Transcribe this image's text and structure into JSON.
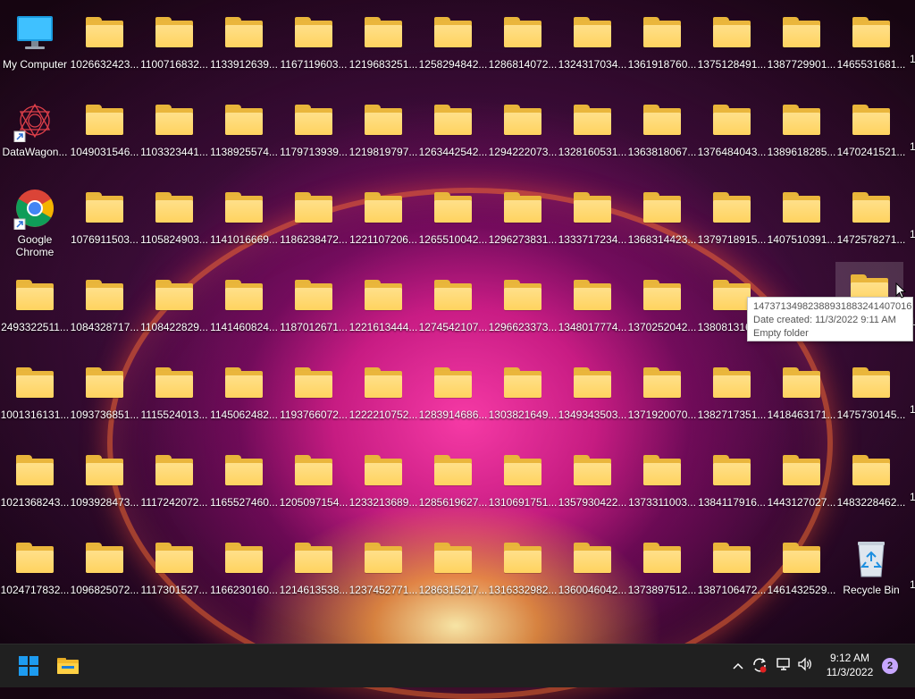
{
  "desktop": {
    "system_icons": [
      {
        "name": "my-computer",
        "label": "My Computer",
        "icon": "monitor-icon"
      },
      {
        "name": "datawagon",
        "label": "DataWagon...",
        "icon": "datawagon-icon"
      },
      {
        "name": "google-chrome",
        "label": "Google Chrome",
        "icon": "chrome-icon"
      },
      {
        "name": "recycle-bin",
        "label": "Recycle Bin",
        "icon": "recycle-bin-icon"
      }
    ],
    "folder_columns": [
      [
        "",
        "",
        "",
        "2493322511...",
        "1001316131...",
        "1021368243...",
        "1024717832..."
      ],
      [
        "1026632423...",
        "1049031546...",
        "1076911503...",
        "1084328717...",
        "1093736851...",
        "1093928473...",
        "1096825072..."
      ],
      [
        "1100716832...",
        "1103323441...",
        "1105824903...",
        "1108422829...",
        "1115524013...",
        "1117242072...",
        "1117301527..."
      ],
      [
        "1133912639...",
        "1138925574...",
        "1141016669...",
        "1141460824...",
        "1145062482...",
        "1165527460...",
        "1166230160..."
      ],
      [
        "1167119603...",
        "1179713939...",
        "1186238472...",
        "1187012671...",
        "1193766072...",
        "1205097154...",
        "1214613538..."
      ],
      [
        "1219683251...",
        "1219819797...",
        "1221107206...",
        "1221613444...",
        "1222210752...",
        "1233213689...",
        "1237452771..."
      ],
      [
        "1258294842...",
        "1263442542...",
        "1265510042...",
        "1274542107...",
        "1283914686...",
        "1285619627...",
        "1286315217..."
      ],
      [
        "1286814072...",
        "1294222073...",
        "1296273831...",
        "1296623373...",
        "1303821649...",
        "1310691751...",
        "1316332982..."
      ],
      [
        "1324317034...",
        "1328160531...",
        "1333717234...",
        "1348017774...",
        "1349343503...",
        "1357930422...",
        "1360046042..."
      ],
      [
        "1361918760...",
        "1363818067...",
        "1368314423...",
        "1370252042...",
        "1371920070...",
        "1373311003...",
        "1373897512..."
      ],
      [
        "1375128491...",
        "1376484043...",
        "1379718915...",
        "1380813160...",
        "1382717351...",
        "1384117916...",
        "1387106472..."
      ],
      [
        "1387729901...",
        "1389618285...",
        "1407510391...",
        "",
        "1418463171...",
        "1443127027...",
        "1461432529..."
      ],
      [
        "1465531681...",
        "1470241521...",
        "1472578271...",
        "",
        "1475730145...",
        "1483228462...",
        ""
      ]
    ],
    "edge_labels": [
      "1",
      "1",
      "1",
      "1",
      "1",
      "1",
      "1"
    ]
  },
  "tooltip": {
    "name": "1473713498238893188324140701​6",
    "name_full": "14737134982388931883241407016",
    "date_created": "Date created: 11/3/2022 9:11 AM",
    "status": "Empty folder"
  },
  "taskbar": {
    "start_icon": "windows-start-icon",
    "explorer_icon": "file-explorer-icon",
    "tray": {
      "chevron": "^",
      "clock_time": "9:12 AM",
      "clock_date": "11/3/2022",
      "notification_count": "2"
    }
  },
  "colors": {
    "taskbar": "#202020",
    "folder": "#ffd35f",
    "start_blue": "#1d9bf0"
  }
}
